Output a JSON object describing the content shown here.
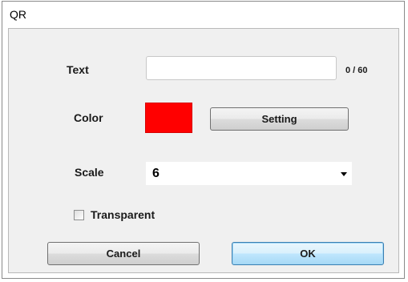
{
  "window": {
    "title": "QR"
  },
  "form": {
    "text_label": "Text",
    "text_value": "",
    "text_counter": "0 / 60",
    "color_label": "Color",
    "color_value": "#ff0000",
    "setting_button": "Setting",
    "scale_label": "Scale",
    "scale_value": "6",
    "transparent_label": "Transparent",
    "transparent_checked": false
  },
  "footer": {
    "cancel_button": "Cancel",
    "ok_button": "OK"
  }
}
